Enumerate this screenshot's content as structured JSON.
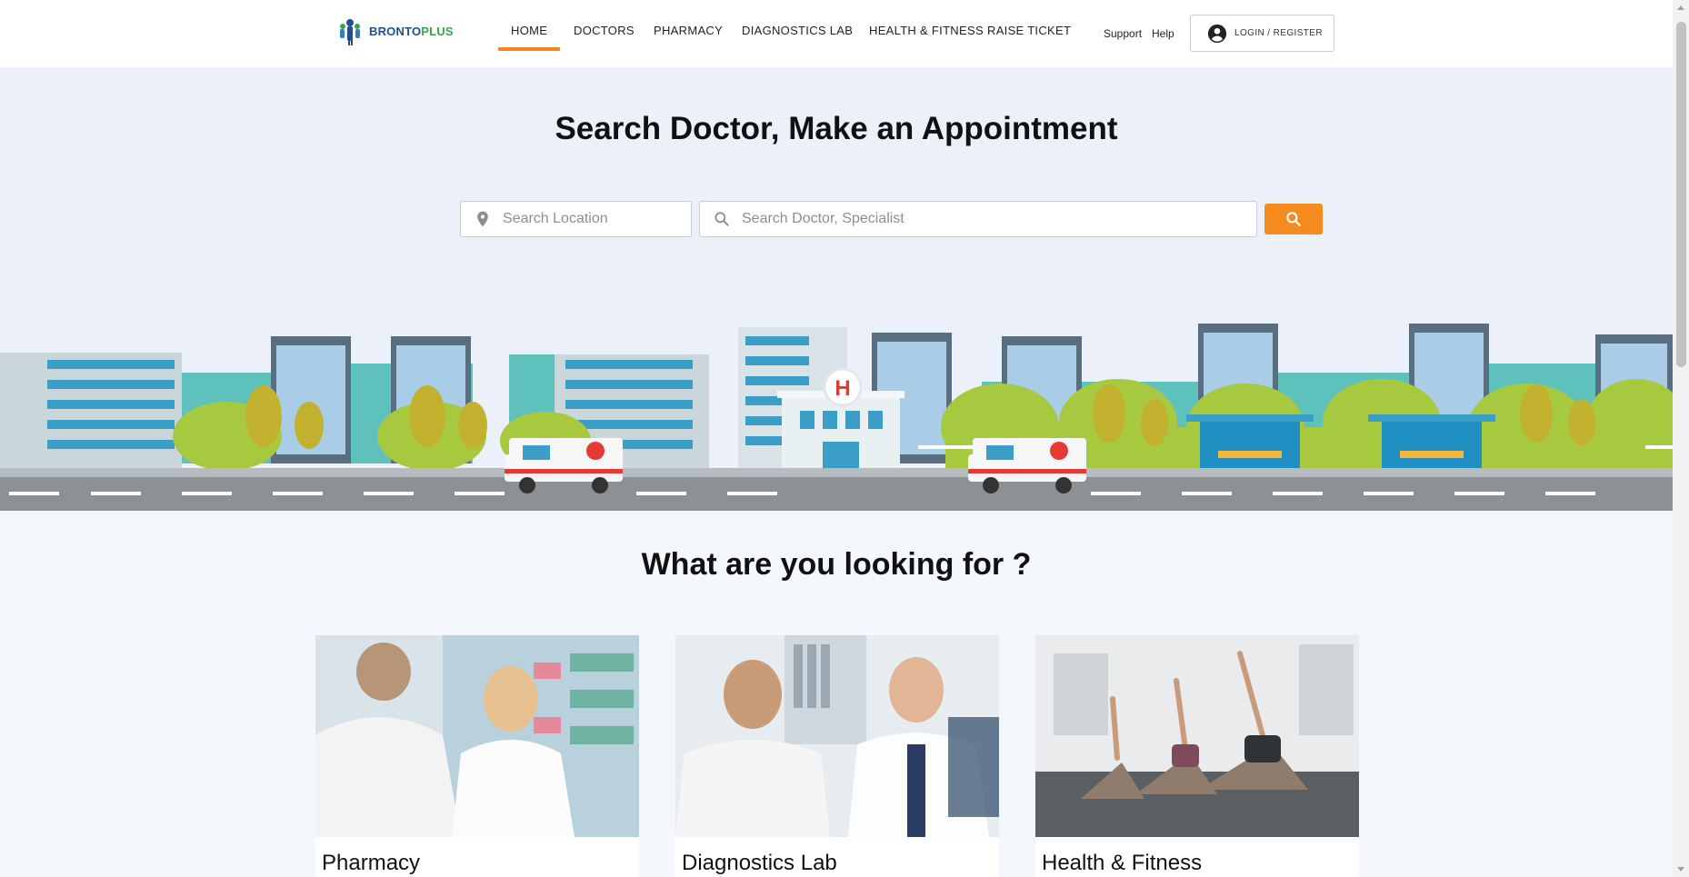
{
  "header": {
    "brand_part1": "BRONTO",
    "brand_part2": "PLUS",
    "nav": [
      {
        "label": "HOME",
        "active": true
      },
      {
        "label": "DOCTORS"
      },
      {
        "label": "PHARMACY"
      },
      {
        "label": "DIAGNOSTICS LAB"
      },
      {
        "label": "HEALTH & FITNESS"
      },
      {
        "label": "RAISE TICKET"
      }
    ],
    "support_label": "Support",
    "help_label": "Help",
    "login_label": "LOGIN / REGISTER"
  },
  "hero": {
    "title": "Search Doctor, Make an Appointment",
    "location_placeholder": "Search Location",
    "doctor_placeholder": "Search Doctor, Specialist",
    "hospital_sign": "H"
  },
  "section": {
    "title": "What are you looking for ?",
    "cards": [
      {
        "label": "Pharmacy"
      },
      {
        "label": "Diagnostics Lab"
      },
      {
        "label": "Health & Fitness"
      }
    ]
  },
  "colors": {
    "accent": "#f58a1f",
    "brand_blue": "#1f4f8f",
    "brand_green": "#37a84a",
    "hero_bg": "#ebf0f9"
  }
}
